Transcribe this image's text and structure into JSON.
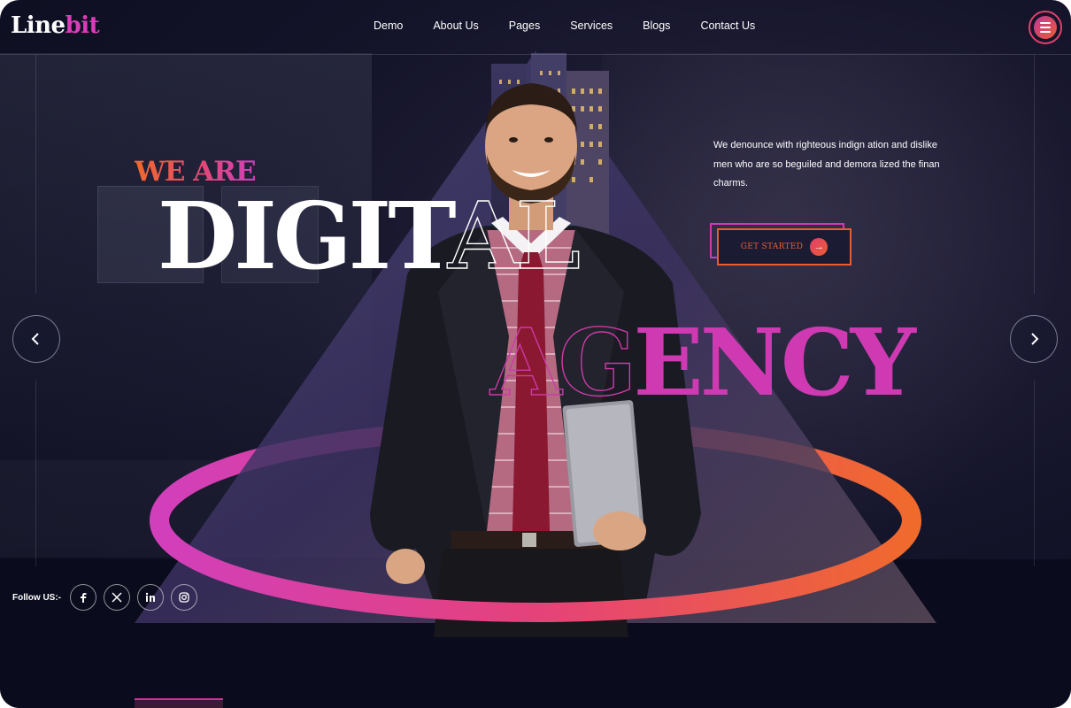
{
  "brand": {
    "logo_main": "Line",
    "logo_accent": "bit"
  },
  "nav": {
    "items": [
      {
        "label": "Demo"
      },
      {
        "label": "About Us"
      },
      {
        "label": "Pages"
      },
      {
        "label": "Services"
      },
      {
        "label": "Blogs"
      },
      {
        "label": "Contact Us"
      }
    ],
    "menu_icon": "hamburger-menu-icon"
  },
  "hero": {
    "kicker": "WE ARE",
    "headline_solid": "DIGIT",
    "headline_outline": "AL",
    "headline2_outline": "AG",
    "headline2_solid": "ENCY",
    "description": "We denounce with righteous indign ation and dislike men who are so beguiled and demora lized the finan charms.",
    "cta_label": "GET STARTED",
    "cta_icon": "arrow-right-icon",
    "prev_icon": "chevron-left-icon",
    "next_icon": "chevron-right-icon"
  },
  "social": {
    "label": "Follow US:-",
    "items": [
      {
        "name": "facebook-icon"
      },
      {
        "name": "x-twitter-icon"
      },
      {
        "name": "linkedin-icon"
      },
      {
        "name": "instagram-icon"
      }
    ]
  },
  "colors": {
    "accent_pink": "#cf3ab2",
    "accent_orange": "#ea5c33",
    "background": "#0b0c1d",
    "text": "#ffffff"
  }
}
